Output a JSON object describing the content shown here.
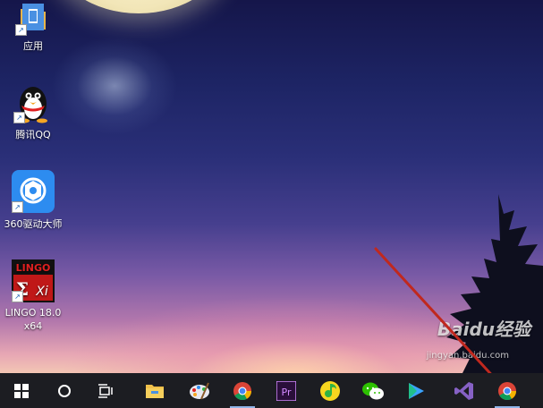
{
  "desktop": {
    "icons": [
      {
        "label": "应用",
        "icon": "folder-icon"
      },
      {
        "label": "腾讯QQ",
        "icon": "qq-penguin-icon"
      },
      {
        "label": "360驱动大师",
        "icon": "360-driver-icon"
      },
      {
        "label": "LINGO 18.0",
        "label2": "x64",
        "icon": "lingo-icon",
        "logo_text": "LINGO",
        "logo_sub": "Xi"
      }
    ]
  },
  "taskbar": {
    "items": [
      {
        "name": "start",
        "icon": "windows-start-icon"
      },
      {
        "name": "search",
        "icon": "cortana-circle-icon"
      },
      {
        "name": "task-view",
        "icon": "task-view-icon"
      },
      {
        "name": "file-explorer",
        "icon": "folder-icon"
      },
      {
        "name": "paint",
        "icon": "paint-icon"
      },
      {
        "name": "chrome",
        "icon": "chrome-icon"
      },
      {
        "name": "premiere",
        "icon": "premiere-icon",
        "text": "Pr"
      },
      {
        "name": "qq-music",
        "icon": "qq-music-icon"
      },
      {
        "name": "wechat",
        "icon": "wechat-icon"
      },
      {
        "name": "video-player",
        "icon": "play-icon"
      },
      {
        "name": "visual-studio",
        "icon": "visual-studio-icon"
      },
      {
        "name": "chrome-2",
        "icon": "chrome-icon"
      }
    ]
  },
  "watermark": {
    "text": "Baidu经验",
    "sub": "jingyan.baidu.com"
  },
  "colors": {
    "taskbar": "#1c1d22",
    "arrow": "#c0281e",
    "active_indicator": "#8fb4e8"
  }
}
